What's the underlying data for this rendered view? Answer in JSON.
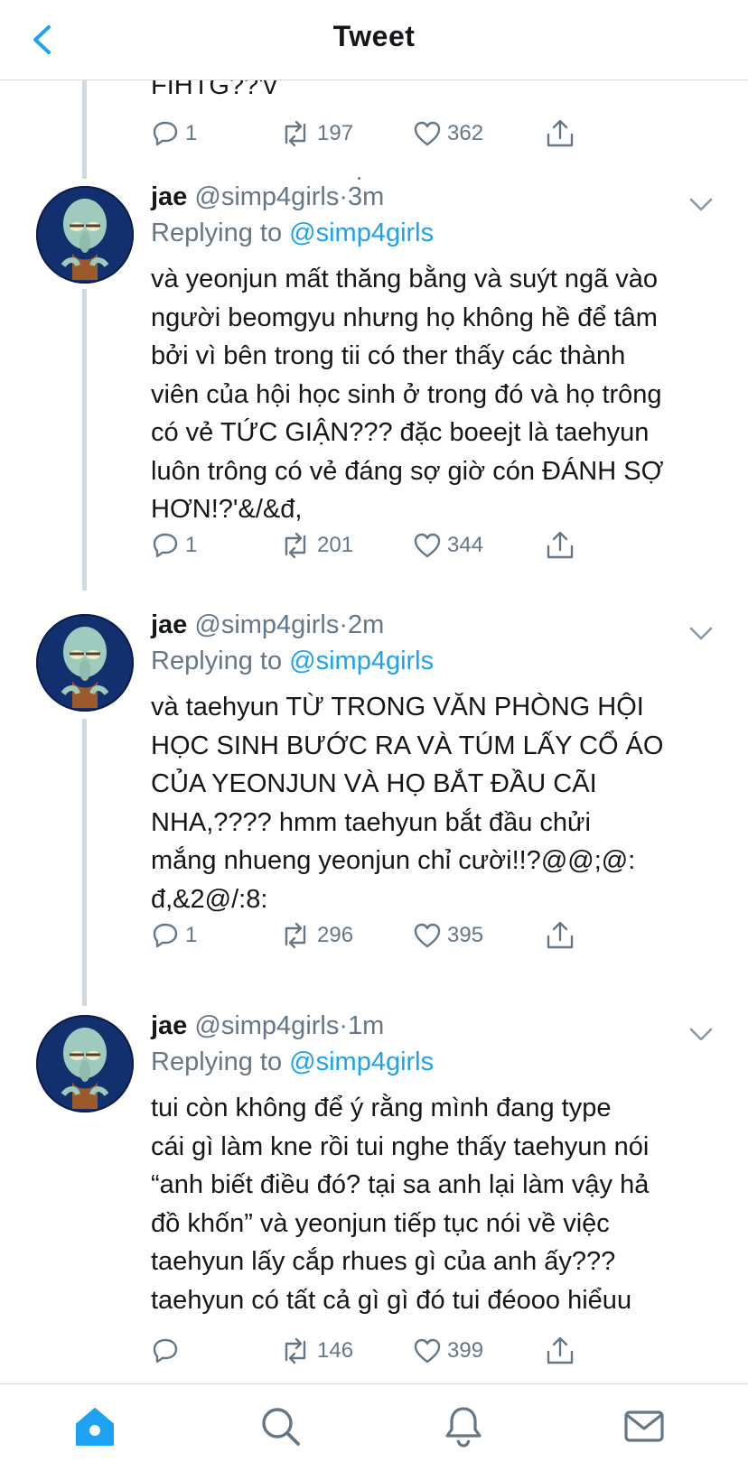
{
  "header": {
    "title": "Tweet",
    "back_icon": "chevron-left-icon"
  },
  "colors": {
    "accent": "#1da1f2",
    "muted": "#657786",
    "text": "#14171a",
    "thread_line": "#cfd9de"
  },
  "prev_tweet": {
    "text_tail": "FIHTG??'v",
    "replies": "1",
    "retweets": "197",
    "likes": "362"
  },
  "tweets": [
    {
      "name": "jae",
      "handle": "@simp4girls",
      "sep": "·",
      "time": "3m",
      "replying_prefix": "Replying to",
      "replying_to": "@simp4girls",
      "text": "và yeonjun mất thăng bằng và suýt ngã vào\nngười beomgyu nhưng họ không hề để tâm\nbởi vì bên trong tii có ther thấy các thành\nviên của hội học sinh ở trong đó và họ trông\ncó vẻ TỨC GIẬN??? đặc boeejt là taehyun\nluôn trông có vẻ đáng sợ giờ cón ĐÁNH SỢ\nHƠN!?'&/&đ,",
      "replies": "1",
      "retweets": "201",
      "likes": "344"
    },
    {
      "name": "jae",
      "handle": "@simp4girls",
      "sep": "·",
      "time": "2m",
      "replying_prefix": "Replying to",
      "replying_to": "@simp4girls",
      "text": "và taehyun TỪ TRONG VĂN PHÒNG HỘI\nHỌC SINH BƯỚC RA VÀ TÚM LẤY CỔ ÁO\nCỦA YEONJUN VÀ HỌ BẮT ĐẦU CÃI\nNHA,???? hmm taehyun bắt đầu chửi\nmắng nhueng yeonjun chỉ cười!!?@@;@:\nđ,&2@/:8:",
      "replies": "1",
      "retweets": "296",
      "likes": "395"
    },
    {
      "name": "jae",
      "handle": "@simp4girls",
      "sep": "·",
      "time": "1m",
      "replying_prefix": "Replying to",
      "replying_to": "@simp4girls",
      "text": "tui còn không để ý rằng mình đang type\ncái gì làm kne rồi tui nghe thấy taehyun nói\n“anh biết điều đó? tại sa anh lại làm vậy hả\nđồ khốn” và yeonjun tiếp tục nói về việc\ntaehyun lấy cắp rhues gì của anh ấy???\ntaehyun có tất cả gì gì đó tui đéooo hiểuu",
      "replies": "",
      "retweets": "146",
      "likes": "399"
    }
  ],
  "tabbar": {
    "items": [
      "home-icon",
      "search-icon",
      "bell-icon",
      "mail-icon"
    ],
    "active": "home-icon"
  }
}
